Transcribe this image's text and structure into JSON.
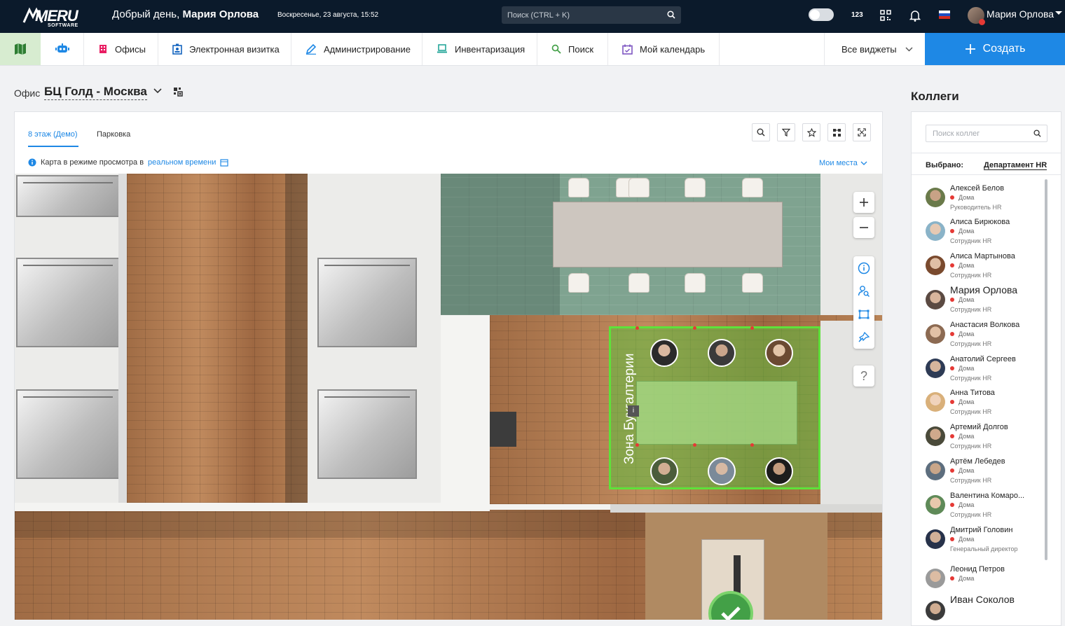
{
  "topbar": {
    "logo": "MERU",
    "logo_sub": "SOFTWARE",
    "greeting_prefix": "Добрый день,",
    "greeting_name": "Мария Орлова",
    "datetime": "Воскресенье, 23 августа, 15:52",
    "search_placeholder": "Поиск (CTRL + K)",
    "counter_label": "123",
    "user_name": "Мария Орлова",
    "icons": [
      "search-icon",
      "toggle-switch",
      "qr-code-icon",
      "bell-icon",
      "russian-flag-icon",
      "chevron-down-icon"
    ]
  },
  "nav": {
    "items": [
      {
        "label": "Офисы",
        "icon": "building-icon",
        "color": "#e91e63"
      },
      {
        "label": "Электронная визитка",
        "icon": "badge-icon",
        "color": "#1565c0"
      },
      {
        "label": "Администрирование",
        "icon": "pencil-icon",
        "color": "#1e88e5"
      },
      {
        "label": "Инвентаризация",
        "icon": "laptop-icon",
        "color": "#26a69a"
      },
      {
        "label": "Поиск",
        "icon": "search-icon",
        "color": "#43a047"
      },
      {
        "label": "Мой календарь",
        "icon": "calendar-icon",
        "color": "#7e57c2"
      }
    ],
    "widgets_label": "Все виджеты",
    "create_label": "Создать",
    "accent": "#1e88e5"
  },
  "office": {
    "label": "Офис",
    "name": "БЦ Голд - Москва"
  },
  "map": {
    "tabs": [
      "8 этаж (Демо)",
      "Парковка"
    ],
    "info_text": "Карта в режиме просмотра в",
    "info_link": "реальном времени",
    "my_places": "Мои места",
    "zone_label": "Зона Бухгалтерии",
    "zone_info": "i",
    "zone_color": "#5ee23a",
    "tools": [
      "search-icon",
      "filter-icon",
      "star-icon",
      "layout-icon",
      "fullscreen-icon"
    ],
    "controls": [
      "zoom-in-icon",
      "zoom-out-icon",
      "info-icon",
      "user-search-icon",
      "area-select-icon",
      "pin-icon",
      "help-icon"
    ],
    "help_label": "?"
  },
  "colleagues": {
    "title": "Коллеги",
    "search_placeholder": "Поиск коллег",
    "selected_label": "Выбрано:",
    "selected_value": "Департамент HR",
    "items": [
      {
        "name": "Алексей Белов",
        "status": "Дома",
        "role": "Руководитель HR"
      },
      {
        "name": "Алиса Бирюкова",
        "status": "Дома",
        "role": "Сотрудник HR"
      },
      {
        "name": "Алиса Мартынова",
        "status": "Дома",
        "role": "Сотрудник HR"
      },
      {
        "name": "Мария Орлова",
        "status": "Дома",
        "role": "Сотрудник HR"
      },
      {
        "name": "Анастасия Волкова",
        "status": "Дома",
        "role": "Сотрудник HR"
      },
      {
        "name": "Анатолий Сергеев",
        "status": "Дома",
        "role": "Сотрудник HR"
      },
      {
        "name": "Анна Титова",
        "status": "Дома",
        "role": "Сотрудник HR"
      },
      {
        "name": "Артемий Долгов",
        "status": "Дома",
        "role": "Сотрудник HR"
      },
      {
        "name": "Артём Лебедев",
        "status": "Дома",
        "role": "Сотрудник HR"
      },
      {
        "name": "Валентина Комаро...",
        "status": "Дома",
        "role": "Сотрудник HR"
      },
      {
        "name": "Дмитрий Головин",
        "status": "Дома",
        "role": "Генеральный директор"
      },
      {
        "name": "Леонид Петров",
        "status": "Дома",
        "role": ""
      },
      {
        "name": "Иван Соколов",
        "status": "",
        "role": ""
      }
    ]
  }
}
